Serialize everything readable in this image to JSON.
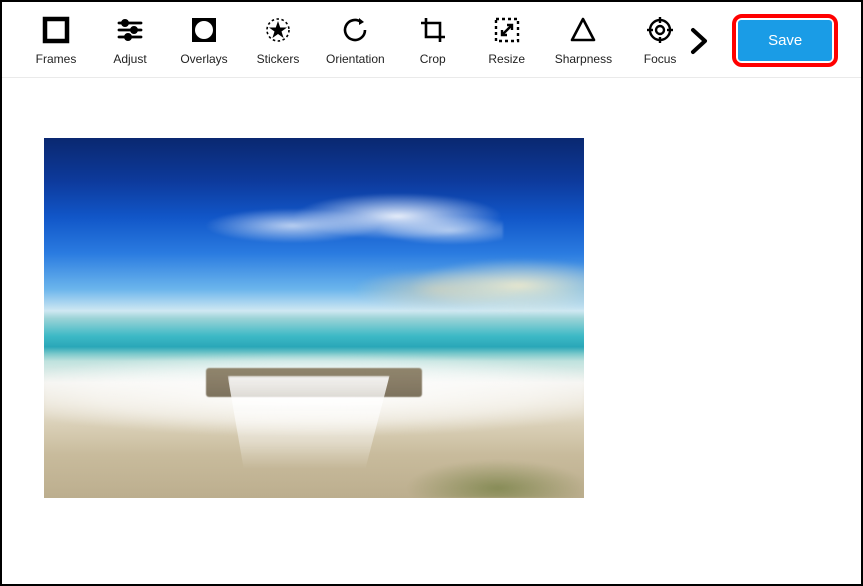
{
  "toolbar": {
    "tools": [
      {
        "name": "frames",
        "label": "Frames"
      },
      {
        "name": "adjust",
        "label": "Adjust"
      },
      {
        "name": "overlays",
        "label": "Overlays"
      },
      {
        "name": "stickers",
        "label": "Stickers"
      },
      {
        "name": "orientation",
        "label": "Orientation"
      },
      {
        "name": "crop",
        "label": "Crop"
      },
      {
        "name": "resize",
        "label": "Resize"
      },
      {
        "name": "sharpness",
        "label": "Sharpness"
      },
      {
        "name": "focus",
        "label": "Focus"
      }
    ],
    "save_label": "Save"
  },
  "colors": {
    "accent": "#1a9ce6",
    "highlight_border": "#ff0000"
  }
}
